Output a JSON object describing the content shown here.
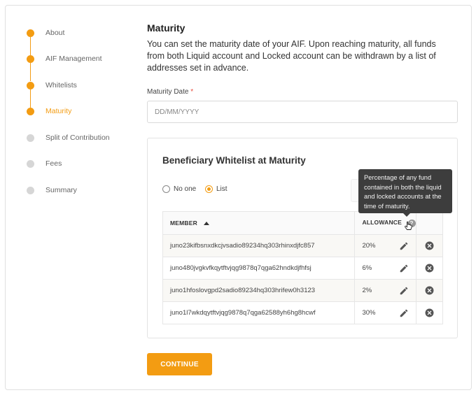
{
  "stepper": {
    "steps": [
      {
        "label": "About",
        "state": "done"
      },
      {
        "label": "AIF Management",
        "state": "done"
      },
      {
        "label": "Whitelists",
        "state": "done"
      },
      {
        "label": "Maturity",
        "state": "active"
      },
      {
        "label": "Split of Contribution",
        "state": "pending"
      },
      {
        "label": "Fees",
        "state": "pending"
      },
      {
        "label": "Summary",
        "state": "pending"
      }
    ]
  },
  "main": {
    "title": "Maturity",
    "description": "You can set the maturity date of your AIF. Upon reaching maturity, all funds from both Liquid account and Locked account can be withdrawn by a list of addresses set in advance.",
    "maturity_date": {
      "label": "Maturity Date",
      "required_mark": "*",
      "placeholder": "DD/MM/YYYY",
      "value": ""
    }
  },
  "whitelist": {
    "title": "Beneficiary Whitelist at Maturity",
    "options": {
      "none": "No one",
      "list": "List",
      "selected": "list"
    },
    "table": {
      "headers": {
        "member": "MEMBER",
        "allowance": "ALLOWANCE"
      },
      "rows": [
        {
          "member": "juno23kifbsnxdkcjvsadio89234hq303rhinxdjfc857",
          "allowance": "20%"
        },
        {
          "member": "juno480jvgkvfkqytftvjqg9878q7qga62hndkdjfhfsj",
          "allowance": "6%"
        },
        {
          "member": "juno1hfoslovgpd2sadio89234hq303hrifew0h3123",
          "allowance": "2%"
        },
        {
          "member": "juno1l7wkdqytftvjqg9878q7qga62588yh6hg8hcwf",
          "allowance": "30%"
        }
      ]
    },
    "tooltip": "Percentage of any fund contained in both the liquid and locked accounts at the time of maturity."
  },
  "actions": {
    "continue_label": "CONTINUE"
  },
  "colors": {
    "accent": "#f39c12",
    "inactive": "#d6d6d6",
    "tooltip_bg": "#3d3d3d"
  },
  "icons": [
    "edit-pencil-icon",
    "remove-circle-icon",
    "info-icon",
    "sort-ascending-icon",
    "pointer-cursor-icon"
  ]
}
